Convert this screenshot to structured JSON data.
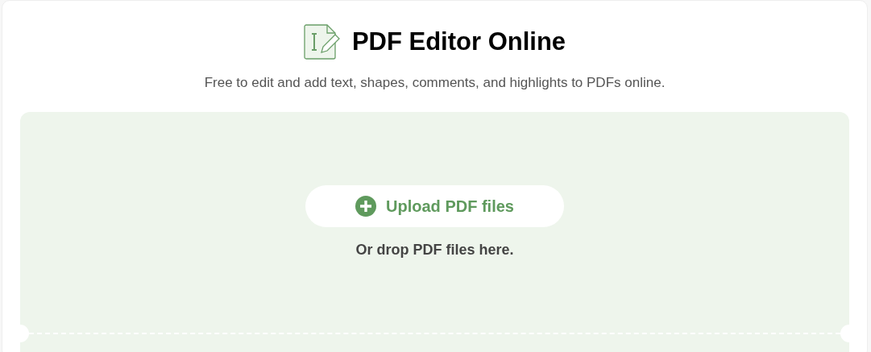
{
  "header": {
    "title": "PDF Editor Online",
    "subtitle": "Free to edit and add text, shapes, comments, and highlights to PDFs online."
  },
  "dropzone": {
    "upload_button": "Upload PDF files",
    "hint": "Or drop PDF files here."
  }
}
